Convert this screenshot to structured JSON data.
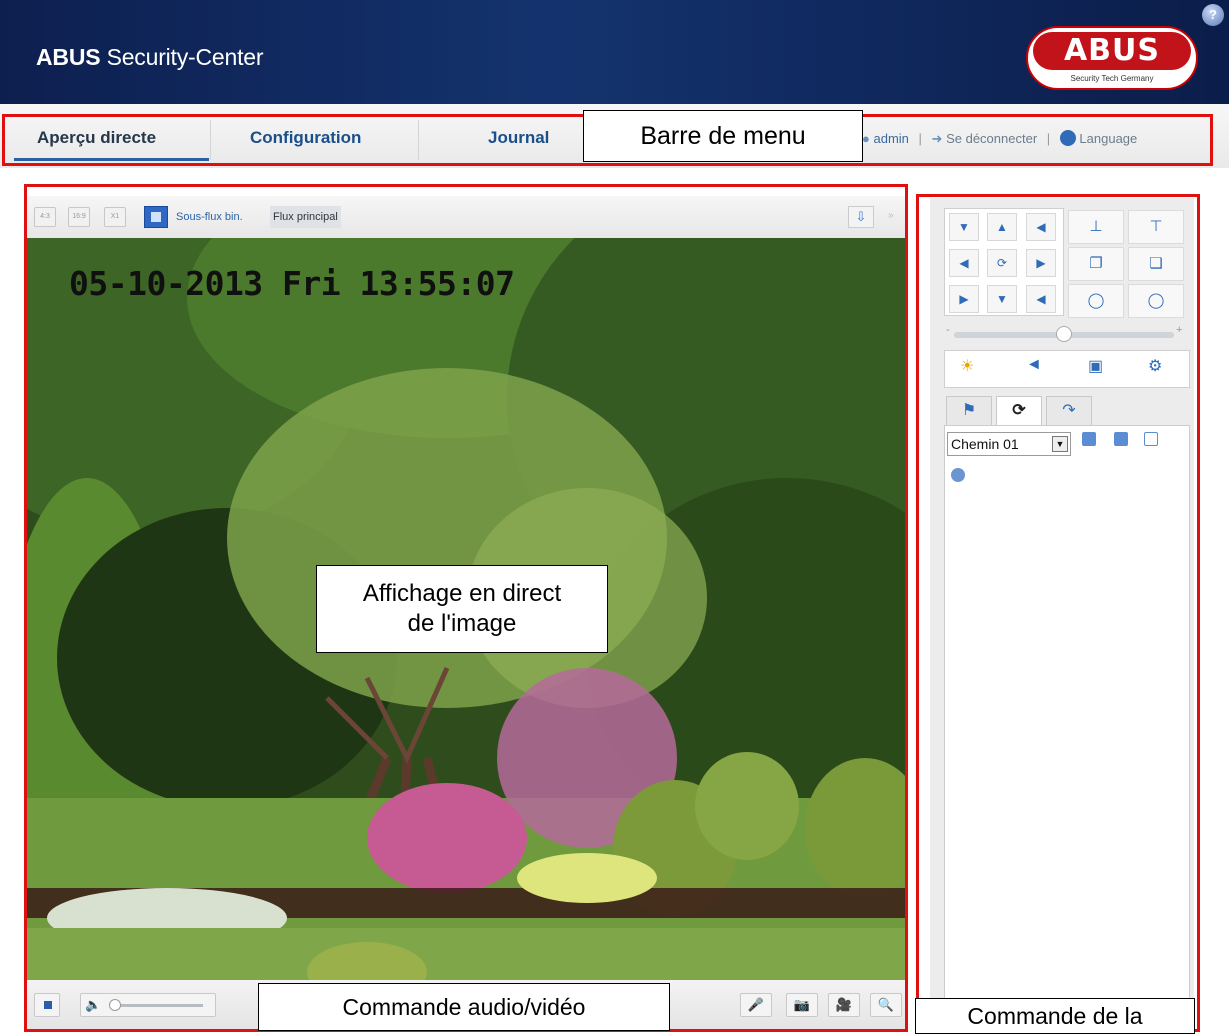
{
  "header": {
    "app_title_bold": "ABUS",
    "app_title_rest": " Security-Center",
    "logo_text": "ABUS",
    "logo_tagline": "Security Tech Germany",
    "help_icon": "?"
  },
  "menu": {
    "tabs": [
      {
        "label": "Aperçu directe",
        "active": true
      },
      {
        "label": "Configuration",
        "active": false
      },
      {
        "label": "Journal",
        "active": false
      }
    ],
    "user": "admin",
    "logout": "Se déconnecter",
    "language": "Language"
  },
  "video_toolbar": {
    "aspect_buttons": [
      "4:3",
      "16:9",
      "X1"
    ],
    "substream_label": "Sous-flux bin.",
    "mainstream_label": "Flux principal",
    "active_stream": "Flux principal"
  },
  "video": {
    "timestamp_overlay": "05-10-2013 Fri 13:55:07"
  },
  "ptz": {
    "speed_level": 0.5,
    "tabs": [
      "preset-icon",
      "patrol-icon",
      "pattern-icon"
    ],
    "active_tab": 1,
    "path_select_value": "Chemin 01"
  },
  "callouts": {
    "menu": "Barre de menu",
    "live_line1": "Affichage en direct",
    "live_line2": "de l'image",
    "av": "Commande audio/vidéo",
    "ptz": "Commande de la"
  },
  "colors": {
    "header_bg": "#14336e",
    "annotation_border": "#e01010",
    "brand_red": "#c3131a",
    "link_blue": "#1b4f8a"
  }
}
